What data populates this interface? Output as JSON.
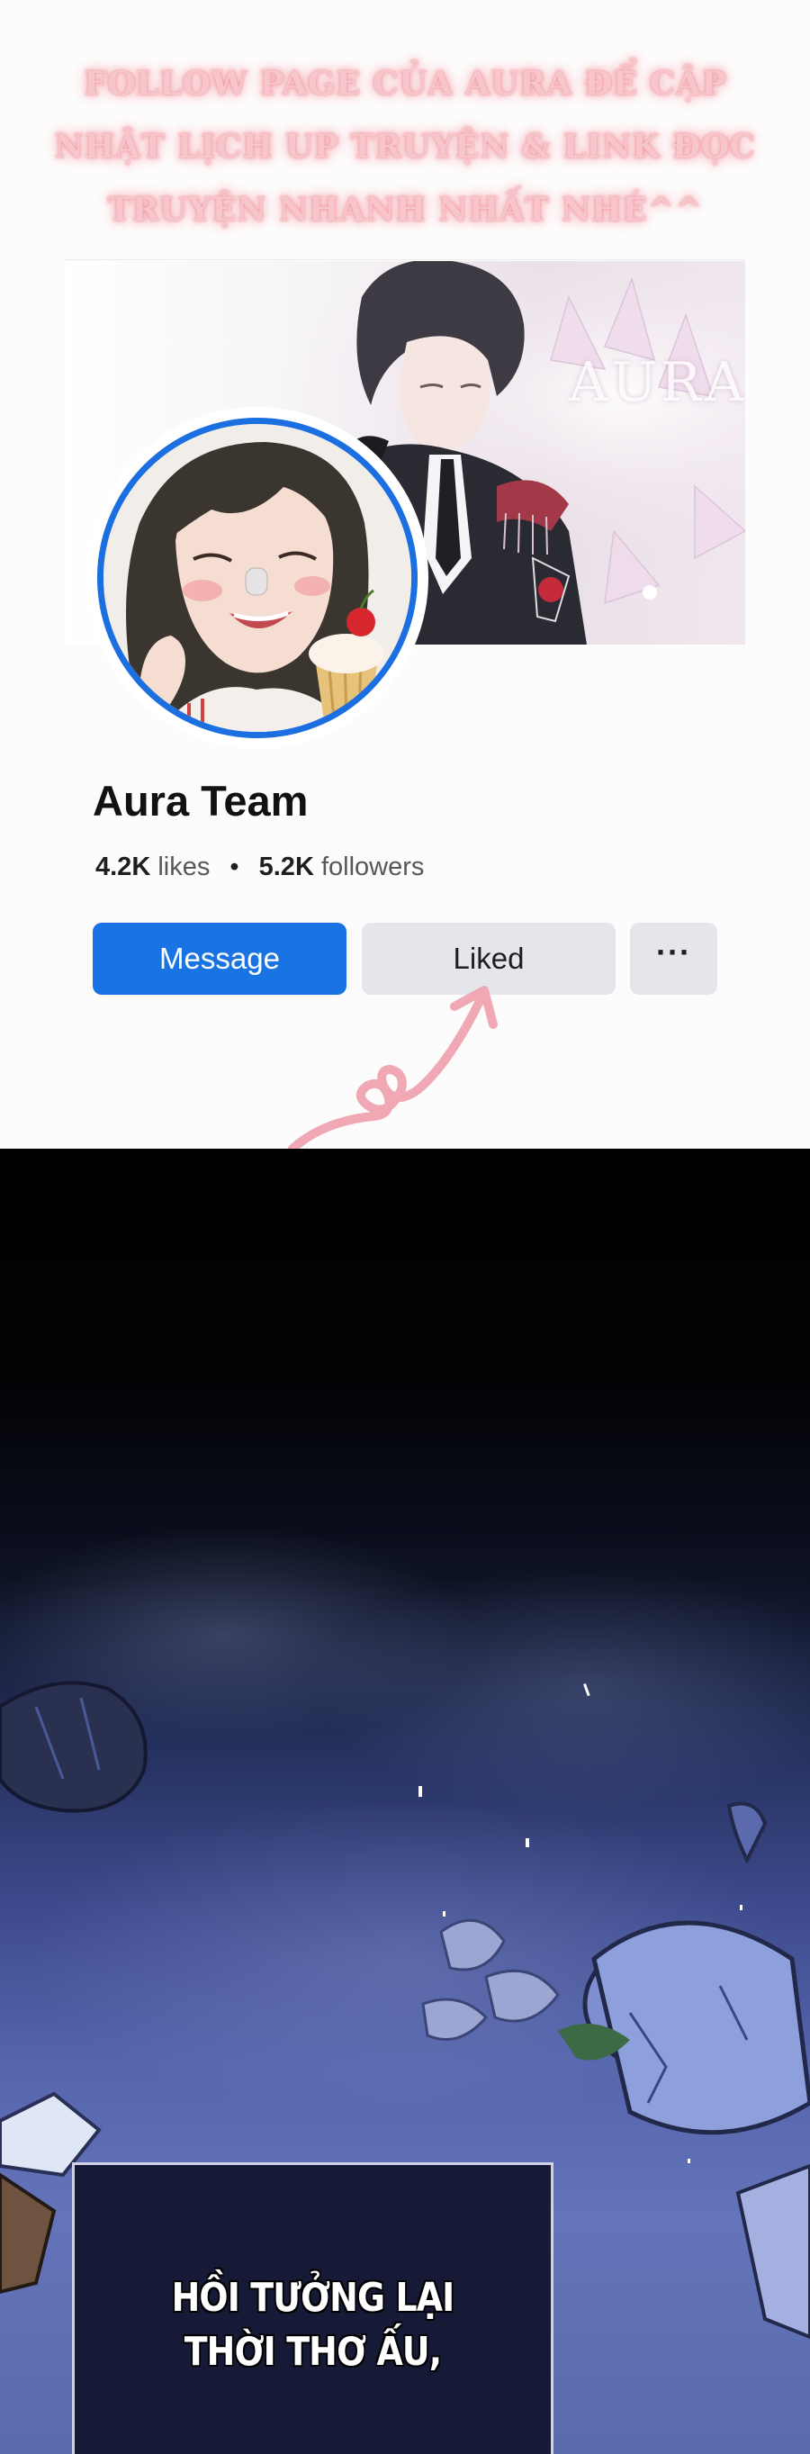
{
  "promo": {
    "heading_lines": [
      "FOLLOW PAGE CỦA AURA ĐỂ CẬP",
      "NHẬT LỊCH UP TRUYỆN  & LINK ĐỌC",
      "TRUYỆN NHANH NHẤT NHÉ^^"
    ],
    "accent_color": "#f4a1aa"
  },
  "profile": {
    "cover_brand": "AURA",
    "name": "Aura Team",
    "likes_count": "4.2K",
    "likes_label": "likes",
    "separator": "•",
    "followers_count": "5.2K",
    "followers_label": "followers",
    "avatar_ring_color": "#1b6fe0"
  },
  "actions": {
    "message_label": "Message",
    "liked_label": "Liked",
    "more_label": "···",
    "message_color": "#1a73e3",
    "secondary_color": "#e4e6eb"
  },
  "icons": {
    "doodle": "arrow-heart-doodle-icon",
    "more": "more-dots-icon"
  },
  "comic": {
    "caption_lines": [
      "HỒI TƯỞNG LẠI",
      "THỜI THƠ ẤU,"
    ]
  }
}
